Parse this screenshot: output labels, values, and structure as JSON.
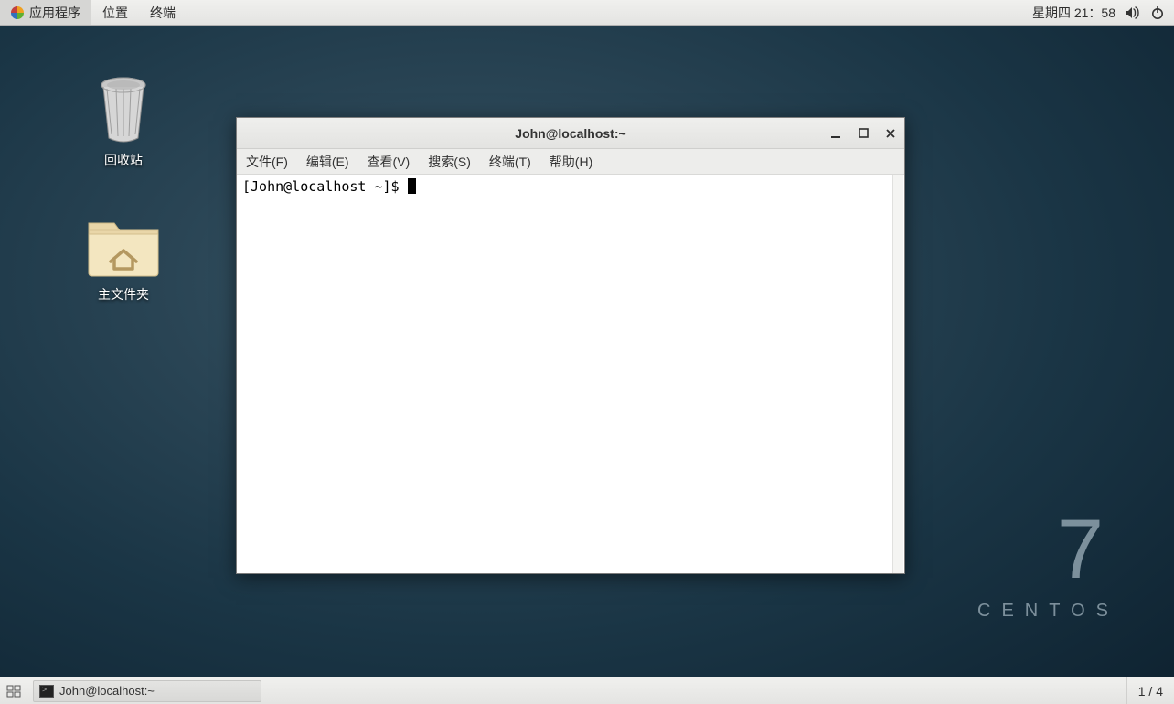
{
  "top_panel": {
    "menus": [
      "应用程序",
      "位置",
      "终端"
    ],
    "clock": "星期四 21：58"
  },
  "desktop_icons": {
    "trash_label": "回收站",
    "home_label": "主文件夹"
  },
  "branding": {
    "version": "7",
    "name": "CENTOS"
  },
  "window": {
    "title": "John@localhost:~",
    "menus": [
      "文件(F)",
      "编辑(E)",
      "查看(V)",
      "搜索(S)",
      "终端(T)",
      "帮助(H)"
    ],
    "prompt": "[John@localhost ~]$ "
  },
  "taskbar": {
    "task_label": "John@localhost:~",
    "workspace": "1 / 4"
  }
}
